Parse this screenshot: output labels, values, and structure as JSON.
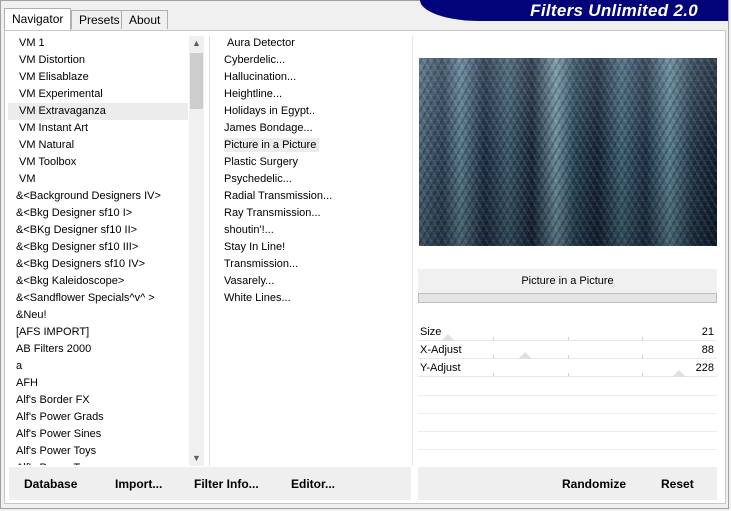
{
  "tabs": [
    {
      "label": "Navigator",
      "active": true
    },
    {
      "label": "Presets",
      "active": false
    },
    {
      "label": "About",
      "active": false
    }
  ],
  "header": {
    "title": "Filters Unlimited 2.0",
    "color": "#03037a"
  },
  "categories": [
    "VM 1",
    "VM Distortion",
    "VM Elisablaze",
    "VM Experimental",
    "VM Extravaganza",
    "VM Instant Art",
    "VM Natural",
    "VM Toolbox",
    "VM",
    "&<Background Designers IV>",
    "&<Bkg Designer sf10 I>",
    "&<BKg Designer sf10 II>",
    "&<Bkg Designer sf10 III>",
    "&<Bkg Designers sf10 IV>",
    "&<Bkg Kaleidoscope>",
    "&<Sandflower Specials^v^ >",
    "&Neu!",
    "[AFS IMPORT]",
    "AB Filters 2000",
    "a",
    "AFH",
    "Alf's Border FX",
    "Alf's Power Grads",
    "Alf's Power Sines",
    "Alf's Power Toys",
    "Alf's Power Toys"
  ],
  "selected_category_index": 4,
  "filters": [
    "Aura Detector",
    "Cyberdelic...",
    "Hallucination...",
    "Heightline...",
    "Holidays in Egypt..",
    "James Bondage...",
    "Picture in a Picture",
    "Plastic Surgery",
    "Psychedelic...",
    "Radial Transmission...",
    "Ray Transmission...",
    "shoutin'!...",
    "Stay In Line!",
    "Transmission...",
    "Vasarely...",
    "White Lines..."
  ],
  "selected_filter_index": 6,
  "selected_filter_name": "Picture in a Picture",
  "params": [
    {
      "label": "Size",
      "value": "21",
      "fraction": 0.08
    },
    {
      "label": "X-Adjust",
      "value": "88",
      "fraction": 0.35
    },
    {
      "label": "Y-Adjust",
      "value": "228",
      "fraction": 0.89
    }
  ],
  "buttons": {
    "database": "Database",
    "import": "Import...",
    "filter_info": "Filter Info...",
    "editor": "Editor...",
    "randomize": "Randomize",
    "reset": "Reset"
  },
  "icons": {
    "scroll_up": "chevron-up-icon",
    "scroll_down": "chevron-down-icon"
  }
}
